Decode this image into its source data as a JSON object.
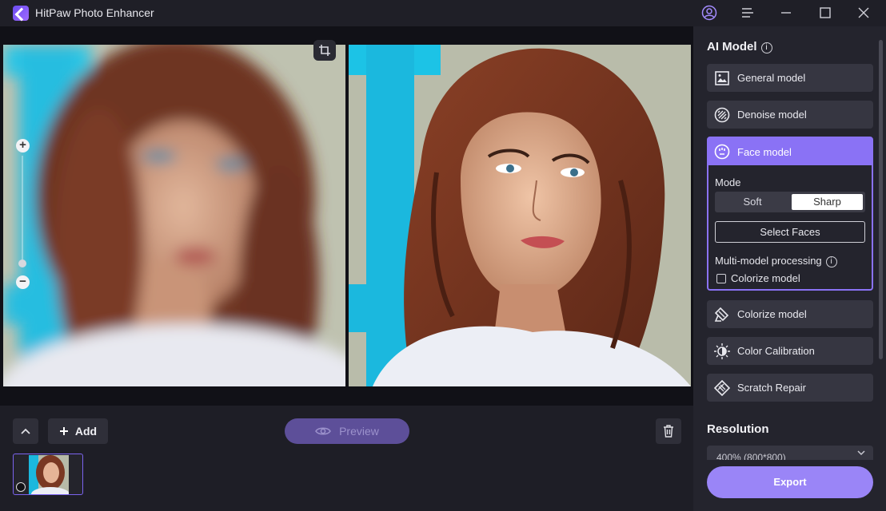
{
  "app": {
    "title": "HitPaw Photo Enhancer"
  },
  "titlebar": {
    "icons": [
      "account-icon",
      "menu-icon",
      "minimize-icon",
      "maximize-icon",
      "close-icon"
    ]
  },
  "canvas": {
    "zoom_in_symbol": "+",
    "zoom_out_symbol": "−",
    "zoom_level_fraction": 0.05
  },
  "bottom": {
    "add_label": "Add",
    "preview_label": "Preview"
  },
  "panel": {
    "ai_model_title": "AI Model",
    "info_symbol": "i",
    "models": [
      {
        "label": "General model",
        "icon": "image-icon"
      },
      {
        "label": "Denoise model",
        "icon": "denoise-icon"
      },
      {
        "label": "Face model",
        "icon": "face-icon"
      },
      {
        "label": "Colorize model",
        "icon": "colorize-icon"
      },
      {
        "label": "Color Calibration",
        "icon": "color-calibration-icon"
      },
      {
        "label": "Scratch Repair",
        "icon": "scratch-repair-icon"
      }
    ],
    "face": {
      "mode_label": "Mode",
      "mode_options": [
        "Soft",
        "Sharp"
      ],
      "selected_mode": "Sharp",
      "select_faces_label": "Select Faces",
      "multi_model_label": "Multi-model processing",
      "colorize_checkbox_label": "Colorize model",
      "colorize_checked": false
    },
    "resolution_title": "Resolution",
    "resolution_value": "400% (800*800)",
    "export_label": "Export"
  },
  "colors": {
    "accent": "#8a72f5",
    "export": "#9a85f7",
    "preview_disabled": "#5d4f99",
    "panel_bg": "#24242d"
  }
}
